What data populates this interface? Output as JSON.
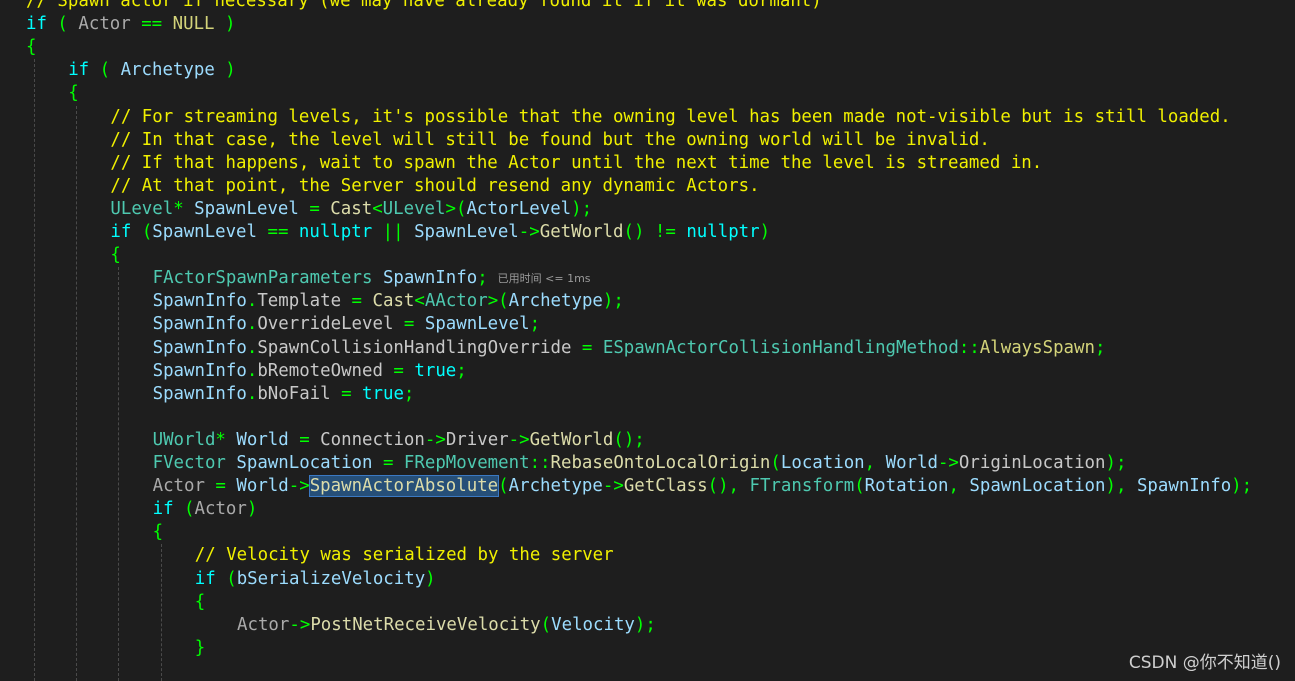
{
  "editor": {
    "lines": [
      {
        "indent": 0,
        "tokens": [
          {
            "t": "// Spawn actor if necessary (we may have already found it if it was dormant)",
            "c": "cm"
          }
        ]
      },
      {
        "indent": 0,
        "tokens": [
          {
            "t": "if",
            "c": "kw"
          },
          {
            "t": " ( ",
            "c": "pu"
          },
          {
            "t": "Actor",
            "c": "ac"
          },
          {
            "t": " == ",
            "c": "pu"
          },
          {
            "t": "NULL",
            "c": "nu"
          },
          {
            "t": " )",
            "c": "pu"
          }
        ]
      },
      {
        "indent": 0,
        "tokens": [
          {
            "t": "{",
            "c": "pu"
          }
        ]
      },
      {
        "indent": 1,
        "tokens": [
          {
            "t": "if",
            "c": "kw"
          },
          {
            "t": " ( ",
            "c": "pu"
          },
          {
            "t": "Archetype",
            "c": "va"
          },
          {
            "t": " )",
            "c": "pu"
          }
        ]
      },
      {
        "indent": 1,
        "tokens": [
          {
            "t": "{",
            "c": "pu"
          }
        ]
      },
      {
        "indent": 2,
        "tokens": [
          {
            "t": "// For streaming levels, it's possible that the owning level has been made not-visible but is still loaded.",
            "c": "cm"
          }
        ]
      },
      {
        "indent": 2,
        "tokens": [
          {
            "t": "// In that case, the level will still be found but the owning world will be invalid.",
            "c": "cm"
          }
        ]
      },
      {
        "indent": 2,
        "tokens": [
          {
            "t": "// If that happens, wait to spawn the Actor until the next time the level is streamed in.",
            "c": "cm"
          }
        ]
      },
      {
        "indent": 2,
        "tokens": [
          {
            "t": "// At that point, the Server should resend any dynamic Actors.",
            "c": "cm"
          }
        ]
      },
      {
        "indent": 2,
        "tokens": [
          {
            "t": "ULevel",
            "c": "ty"
          },
          {
            "t": "* ",
            "c": "pu"
          },
          {
            "t": "SpawnLevel",
            "c": "va"
          },
          {
            "t": " = ",
            "c": "pu"
          },
          {
            "t": "Cast",
            "c": "fn"
          },
          {
            "t": "<",
            "c": "pu"
          },
          {
            "t": "ULevel",
            "c": "ty"
          },
          {
            "t": ">(",
            "c": "pu"
          },
          {
            "t": "ActorLevel",
            "c": "va"
          },
          {
            "t": ");",
            "c": "pu"
          }
        ]
      },
      {
        "indent": 2,
        "tokens": [
          {
            "t": "if",
            "c": "kw"
          },
          {
            "t": " (",
            "c": "pu"
          },
          {
            "t": "SpawnLevel",
            "c": "va"
          },
          {
            "t": " == ",
            "c": "pu"
          },
          {
            "t": "nullptr",
            "c": "kw"
          },
          {
            "t": " || ",
            "c": "pu"
          },
          {
            "t": "SpawnLevel",
            "c": "va"
          },
          {
            "t": "->",
            "c": "pu"
          },
          {
            "t": "GetWorld",
            "c": "fn"
          },
          {
            "t": "() != ",
            "c": "pu"
          },
          {
            "t": "nullptr",
            "c": "kw"
          },
          {
            "t": ")",
            "c": "pu"
          }
        ]
      },
      {
        "indent": 2,
        "tokens": [
          {
            "t": "{",
            "c": "pu"
          }
        ]
      },
      {
        "indent": 3,
        "tokens": [
          {
            "t": "FActorSpawnParameters",
            "c": "ty"
          },
          {
            "t": " ",
            "c": "pu"
          },
          {
            "t": "SpawnInfo",
            "c": "va"
          },
          {
            "t": ";",
            "c": "pu"
          }
        ],
        "hint": "已用时间 <= 1ms"
      },
      {
        "indent": 3,
        "tokens": [
          {
            "t": "SpawnInfo",
            "c": "va"
          },
          {
            "t": ".",
            "c": "pu"
          },
          {
            "t": "Template",
            "c": "mb"
          },
          {
            "t": " = ",
            "c": "pu"
          },
          {
            "t": "Cast",
            "c": "fn"
          },
          {
            "t": "<",
            "c": "pu"
          },
          {
            "t": "AActor",
            "c": "ty"
          },
          {
            "t": ">(",
            "c": "pu"
          },
          {
            "t": "Archetype",
            "c": "va"
          },
          {
            "t": ");",
            "c": "pu"
          }
        ]
      },
      {
        "indent": 3,
        "tokens": [
          {
            "t": "SpawnInfo",
            "c": "va"
          },
          {
            "t": ".",
            "c": "pu"
          },
          {
            "t": "OverrideLevel",
            "c": "mb"
          },
          {
            "t": " = ",
            "c": "pu"
          },
          {
            "t": "SpawnLevel",
            "c": "va"
          },
          {
            "t": ";",
            "c": "pu"
          }
        ]
      },
      {
        "indent": 3,
        "tokens": [
          {
            "t": "SpawnInfo",
            "c": "va"
          },
          {
            "t": ".",
            "c": "pu"
          },
          {
            "t": "SpawnCollisionHandlingOverride",
            "c": "mb"
          },
          {
            "t": " = ",
            "c": "pu"
          },
          {
            "t": "ESpawnActorCollisionHandlingMethod",
            "c": "ty"
          },
          {
            "t": "::",
            "c": "pu"
          },
          {
            "t": "AlwaysSpawn",
            "c": "nu"
          },
          {
            "t": ";",
            "c": "pu"
          }
        ]
      },
      {
        "indent": 3,
        "tokens": [
          {
            "t": "SpawnInfo",
            "c": "va"
          },
          {
            "t": ".",
            "c": "pu"
          },
          {
            "t": "bRemoteOwned",
            "c": "mb"
          },
          {
            "t": " = ",
            "c": "pu"
          },
          {
            "t": "true",
            "c": "kw"
          },
          {
            "t": ";",
            "c": "pu"
          }
        ]
      },
      {
        "indent": 3,
        "tokens": [
          {
            "t": "SpawnInfo",
            "c": "va"
          },
          {
            "t": ".",
            "c": "pu"
          },
          {
            "t": "bNoFail",
            "c": "mb"
          },
          {
            "t": " = ",
            "c": "pu"
          },
          {
            "t": "true",
            "c": "kw"
          },
          {
            "t": ";",
            "c": "pu"
          }
        ]
      },
      {
        "indent": 3,
        "tokens": []
      },
      {
        "indent": 3,
        "tokens": [
          {
            "t": "UWorld",
            "c": "ty"
          },
          {
            "t": "* ",
            "c": "pu"
          },
          {
            "t": "World",
            "c": "va"
          },
          {
            "t": " = ",
            "c": "pu"
          },
          {
            "t": "Connection",
            "c": "mb"
          },
          {
            "t": "->",
            "c": "pu"
          },
          {
            "t": "Driver",
            "c": "mb"
          },
          {
            "t": "->",
            "c": "pu"
          },
          {
            "t": "GetWorld",
            "c": "fn"
          },
          {
            "t": "();",
            "c": "pu"
          }
        ]
      },
      {
        "indent": 3,
        "tokens": [
          {
            "t": "FVector",
            "c": "ty"
          },
          {
            "t": " ",
            "c": "pu"
          },
          {
            "t": "SpawnLocation",
            "c": "va"
          },
          {
            "t": " = ",
            "c": "pu"
          },
          {
            "t": "FRepMovement",
            "c": "ty"
          },
          {
            "t": "::",
            "c": "pu"
          },
          {
            "t": "RebaseOntoLocalOrigin",
            "c": "fn"
          },
          {
            "t": "(",
            "c": "pu"
          },
          {
            "t": "Location",
            "c": "va"
          },
          {
            "t": ", ",
            "c": "pu"
          },
          {
            "t": "World",
            "c": "va"
          },
          {
            "t": "->",
            "c": "pu"
          },
          {
            "t": "OriginLocation",
            "c": "mb"
          },
          {
            "t": ");",
            "c": "pu"
          }
        ]
      },
      {
        "indent": 3,
        "tokens": [
          {
            "t": "Actor",
            "c": "ac"
          },
          {
            "t": " = ",
            "c": "pu"
          },
          {
            "t": "World",
            "c": "va"
          },
          {
            "t": "->",
            "c": "pu"
          },
          {
            "t": "SpawnActorAbsolute",
            "c": "fn",
            "hl": true
          },
          {
            "t": "(",
            "c": "pu"
          },
          {
            "t": "Archetype",
            "c": "va"
          },
          {
            "t": "->",
            "c": "pu"
          },
          {
            "t": "GetClass",
            "c": "fn"
          },
          {
            "t": "(), ",
            "c": "pu"
          },
          {
            "t": "FTransform",
            "c": "ty"
          },
          {
            "t": "(",
            "c": "pu"
          },
          {
            "t": "Rotation",
            "c": "va"
          },
          {
            "t": ", ",
            "c": "pu"
          },
          {
            "t": "SpawnLocation",
            "c": "va"
          },
          {
            "t": "), ",
            "c": "pu"
          },
          {
            "t": "SpawnInfo",
            "c": "va"
          },
          {
            "t": ");",
            "c": "pu"
          }
        ]
      },
      {
        "indent": 3,
        "tokens": [
          {
            "t": "if",
            "c": "kw"
          },
          {
            "t": " (",
            "c": "pu"
          },
          {
            "t": "Actor",
            "c": "ac"
          },
          {
            "t": ")",
            "c": "pu"
          }
        ]
      },
      {
        "indent": 3,
        "tokens": [
          {
            "t": "{",
            "c": "pu"
          }
        ]
      },
      {
        "indent": 4,
        "tokens": [
          {
            "t": "// Velocity was serialized by the server",
            "c": "cm"
          }
        ]
      },
      {
        "indent": 4,
        "tokens": [
          {
            "t": "if",
            "c": "kw"
          },
          {
            "t": " (",
            "c": "pu"
          },
          {
            "t": "bSerializeVelocity",
            "c": "va"
          },
          {
            "t": ")",
            "c": "pu"
          }
        ]
      },
      {
        "indent": 4,
        "tokens": [
          {
            "t": "{",
            "c": "pu"
          }
        ]
      },
      {
        "indent": 5,
        "tokens": [
          {
            "t": "Actor",
            "c": "ac"
          },
          {
            "t": "->",
            "c": "pu"
          },
          {
            "t": "PostNetReceiveVelocity",
            "c": "fn"
          },
          {
            "t": "(",
            "c": "pu"
          },
          {
            "t": "Velocity",
            "c": "va"
          },
          {
            "t": ");",
            "c": "pu"
          }
        ]
      },
      {
        "indent": 4,
        "tokens": [
          {
            "t": "}",
            "c": "pu"
          }
        ]
      }
    ]
  },
  "watermark": "CSDN @你不知道()"
}
